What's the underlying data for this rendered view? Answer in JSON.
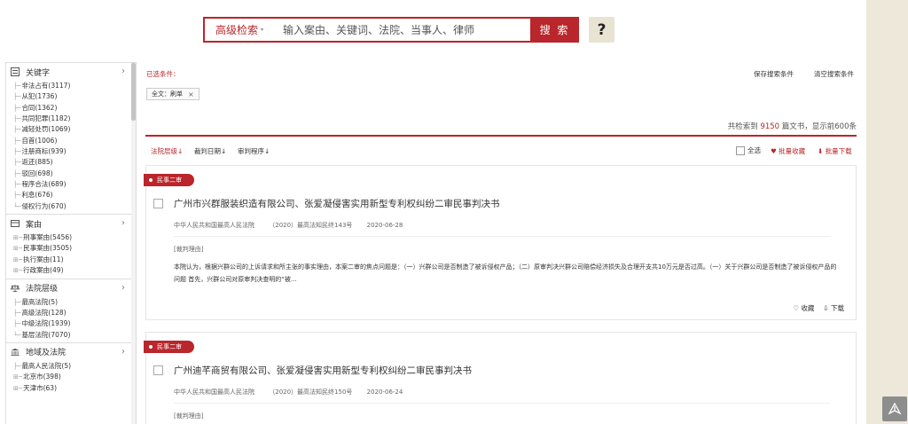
{
  "search": {
    "advanced_label": "高级检索",
    "placeholder": "输入案由、关键词、法院、当事人、律师",
    "button_label": "搜 索",
    "help_label": "?"
  },
  "sidebar": {
    "sections": [
      {
        "title": "关键字",
        "icon": "keyword-icon",
        "items": [
          "非法占有(3117)",
          "从犯(1736)",
          "合同(1362)",
          "共同犯罪(1182)",
          "减轻处罚(1069)",
          "自首(1006)",
          "注册商标(939)",
          "返还(885)",
          "驳回(698)",
          "程序合法(689)",
          "利息(676)",
          "侵权行为(670)"
        ]
      },
      {
        "title": "案由",
        "icon": "case-icon",
        "items": [
          "刑事案由(5456)",
          "民事案由(3505)",
          "执行案由(11)",
          "行政案由(49)"
        ]
      },
      {
        "title": "法院层级",
        "icon": "scale-icon",
        "items": [
          "最高法院(5)",
          "高级法院(128)",
          "中级法院(1939)",
          "基层法院(7070)"
        ]
      },
      {
        "title": "地域及法院",
        "icon": "building-icon",
        "items": [
          "最高人民法院(5)",
          "北京市(398)",
          "天津市(63)"
        ]
      }
    ]
  },
  "criteria": {
    "label": "已选条件：",
    "save_label": "保存搜索条件",
    "clear_label": "清空搜索条件",
    "tag_text": "全文：刷单",
    "tag_close": "×"
  },
  "results": {
    "prefix": "共检索到 ",
    "count": "9150",
    "suffix": " 篇文书，显示前600条"
  },
  "sort": {
    "court_level": "法院层级↓",
    "judge_date": "裁判日期↓",
    "procedure": "审判程序↓",
    "select_all": "全选",
    "batch_fav": "♥ 批量收藏",
    "batch_download": "⬇ 批量下载"
  },
  "cards": [
    {
      "badge": "民事二审",
      "title": "广州市兴群服装织造有限公司、张爱凝侵害实用新型专利权纠纷二审民事判决书",
      "court": "中华人民共和国最高人民法院",
      "case_no": "（2020）最高法知民终143号",
      "date": "2020-06-28",
      "reason_label": "[裁判理由]",
      "excerpt": "本院认为，根据兴群公司的上诉请求和所主张的事实理由，本案二审的焦点问题是：（一）兴群公司是否制造了被诉侵权产品；（二）原审判决兴群公司赔偿经济损失及合理开支共10万元是否过高。（一）关于兴群公司是否制造了被诉侵权产品的问题 首先，兴群公司对原审判决查明的“被...",
      "fav_label": "♡ 收藏",
      "download_label": "⇩ 下载"
    },
    {
      "badge": "民事二审",
      "title": "广州迪芊商贸有限公司、张爱凝侵害实用新型专利权纠纷二审民事判决书",
      "court": "中华人民共和国最高人民法院",
      "case_no": "（2020）最高法知民终150号",
      "date": "2020-06-24",
      "reason_label": "[裁判理由]"
    }
  ]
}
